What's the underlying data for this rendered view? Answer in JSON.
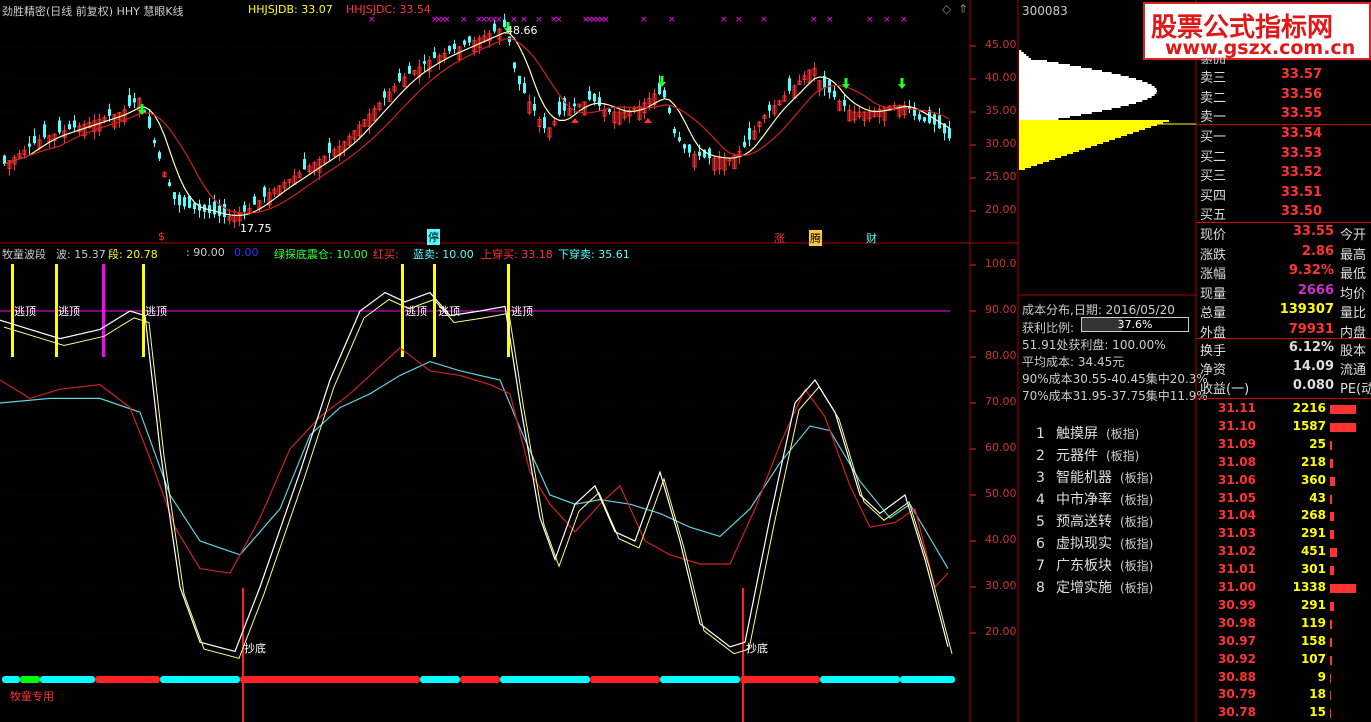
{
  "window": {
    "top_left_title": "劲胜精密(日线 前复权) HHY 慧眼K线",
    "indicator1": "HHJSJDB: 33.07",
    "indicator2": "HHJSJDC: 33.54",
    "stock_code": "300083"
  },
  "watermark": {
    "line1": "股票公式指标网",
    "line2": "www.gszx.com.cn"
  },
  "price_chart": {
    "y_ticks": [
      "45.00",
      "40.00",
      "35.00",
      "30.00",
      "25.00",
      "20.00"
    ],
    "high_label": "48.66",
    "low_label": "17.75",
    "bottom_tags": [
      "$",
      "停",
      "涨",
      "腾",
      "财"
    ]
  },
  "sub_chart": {
    "title": "牧童波段",
    "label_bo": "波: 15.37",
    "label_duan": "段: 20.78",
    "label_90": ": 90.00",
    "label_0": "0.00",
    "label_green": "绿探底震仓: 10.00",
    "label_red": "红买:",
    "label_blue": "蓝卖: 10.00",
    "label_up": "上穿买: 33.18",
    "label_down": "下穿卖: 35.61",
    "y_ticks": [
      "100.0",
      "90.00",
      "80.00",
      "70.00",
      "60.00",
      "50.00",
      "40.00",
      "30.00",
      "20.00"
    ],
    "top_marks": [
      "逃顶",
      "逃顶",
      "逃顶",
      "逃顶",
      "逃顶",
      "逃顶"
    ],
    "bottom_marks": [
      "抄底",
      "抄底"
    ],
    "footer": "牧童专用"
  },
  "cost": {
    "date": "成本分布,日期: 2016/05/20",
    "profit_label": "获利比例:",
    "profit_value": "37.6%",
    "line1": "51.91处获利盘: 100.00%",
    "line2": "平均成本: 34.45元",
    "line3": "90%成本30.55-40.45集中20.3%",
    "line4": "70%成本31.95-37.75集中11.9%"
  },
  "hot_list": [
    {
      "num": "1",
      "name": "触摸屏",
      "tag": "(板指)"
    },
    {
      "num": "2",
      "name": "元器件",
      "tag": "(板指)"
    },
    {
      "num": "3",
      "name": "智能机器",
      "tag": "(板指)"
    },
    {
      "num": "4",
      "name": "中市净率",
      "tag": "(板指)"
    },
    {
      "num": "5",
      "name": "预高送转",
      "tag": "(板指)"
    },
    {
      "num": "6",
      "name": "虚拟现实",
      "tag": "(板指)"
    },
    {
      "num": "7",
      "name": "广东板块",
      "tag": "(板指)"
    },
    {
      "num": "8",
      "name": "定增实施",
      "tag": "(板指)"
    }
  ],
  "orderbook": [
    {
      "name": "卖四",
      "price": ""
    },
    {
      "name": "卖三",
      "price": "33.57"
    },
    {
      "name": "卖二",
      "price": "33.56"
    },
    {
      "name": "卖一",
      "price": "33.55"
    },
    {
      "name": "买一",
      "price": "33.54"
    },
    {
      "name": "买二",
      "price": "33.53"
    },
    {
      "name": "买三",
      "price": "33.52"
    },
    {
      "name": "买四",
      "price": "33.51"
    },
    {
      "name": "买五",
      "price": "33.50"
    }
  ],
  "quote": [
    {
      "name": "现价",
      "value": "33.55",
      "label": "今开",
      "color": "#f33"
    },
    {
      "name": "涨跌",
      "value": "2.86",
      "label": "最高",
      "color": "#f33"
    },
    {
      "name": "涨幅",
      "value": "9.32%",
      "label": "最低",
      "color": "#f33"
    },
    {
      "name": "现量",
      "value": "2666",
      "label": "均价",
      "color": "#c3c"
    },
    {
      "name": "总量",
      "value": "139307",
      "label": "量比",
      "color": "#ff0"
    },
    {
      "name": "外盘",
      "value": "79931",
      "label": "内盘",
      "color": "#f33"
    }
  ],
  "quote2": [
    {
      "name": "换手",
      "value": "6.12%",
      "label": "股本",
      "color": "#ddd"
    },
    {
      "name": "净资",
      "value": "14.09",
      "label": "流通",
      "color": "#ddd"
    },
    {
      "name": "收益(一)",
      "value": "0.080",
      "label": "PE(动)",
      "color": "#ddd"
    }
  ],
  "depth": [
    {
      "price": "31.11",
      "vol": "2216",
      "bar": 26
    },
    {
      "price": "31.10",
      "vol": "1587",
      "bar": 26
    },
    {
      "price": "31.09",
      "vol": "25",
      "bar": 2
    },
    {
      "price": "31.08",
      "vol": "218",
      "bar": 3
    },
    {
      "price": "31.06",
      "vol": "360",
      "bar": 5
    },
    {
      "price": "31.05",
      "vol": "43",
      "bar": 2
    },
    {
      "price": "31.04",
      "vol": "268",
      "bar": 4
    },
    {
      "price": "31.03",
      "vol": "291",
      "bar": 4
    },
    {
      "price": "31.02",
      "vol": "451",
      "bar": 7
    },
    {
      "price": "31.01",
      "vol": "301",
      "bar": 4
    },
    {
      "price": "31.00",
      "vol": "1338",
      "bar": 26
    },
    {
      "price": "30.99",
      "vol": "291",
      "bar": 4
    },
    {
      "price": "30.98",
      "vol": "119",
      "bar": 2
    },
    {
      "price": "30.97",
      "vol": "158",
      "bar": 2
    },
    {
      "price": "30.92",
      "vol": "107",
      "bar": 2
    },
    {
      "price": "30.88",
      "vol": "9",
      "bar": 1
    },
    {
      "price": "30.79",
      "vol": "18",
      "bar": 1
    },
    {
      "price": "30.78",
      "vol": "15",
      "bar": 1
    }
  ],
  "colors": {
    "up": "#ff3232",
    "down": "#54ffff",
    "ma1": "#ffffc0",
    "ma2": "#d02020",
    "accent": "#ff00ff"
  }
}
